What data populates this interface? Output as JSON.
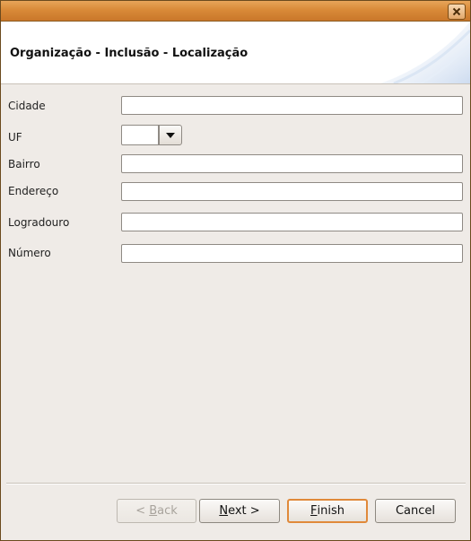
{
  "window": {
    "close_icon": "close-icon"
  },
  "banner": {
    "title": "Organização - Inclusão - Localização"
  },
  "form": {
    "cidade": {
      "label": "Cidade",
      "value": ""
    },
    "uf": {
      "label": "UF",
      "value": ""
    },
    "bairro": {
      "label": "Bairro",
      "value": ""
    },
    "endereco": {
      "label": "Endereço",
      "value": ""
    },
    "logradouro": {
      "label": "Logradouro",
      "value": ""
    },
    "numero": {
      "label": "Número",
      "value": ""
    }
  },
  "buttons": {
    "back": {
      "prefix": "< ",
      "mnemonic": "B",
      "rest": "ack"
    },
    "next": {
      "mnemonic": "N",
      "rest": "ext >"
    },
    "finish": {
      "mnemonic": "F",
      "rest": "inish"
    },
    "cancel": {
      "label": "Cancel"
    }
  },
  "colors": {
    "titlebar": "#d98a38",
    "default_button_border": "#e0893a"
  }
}
